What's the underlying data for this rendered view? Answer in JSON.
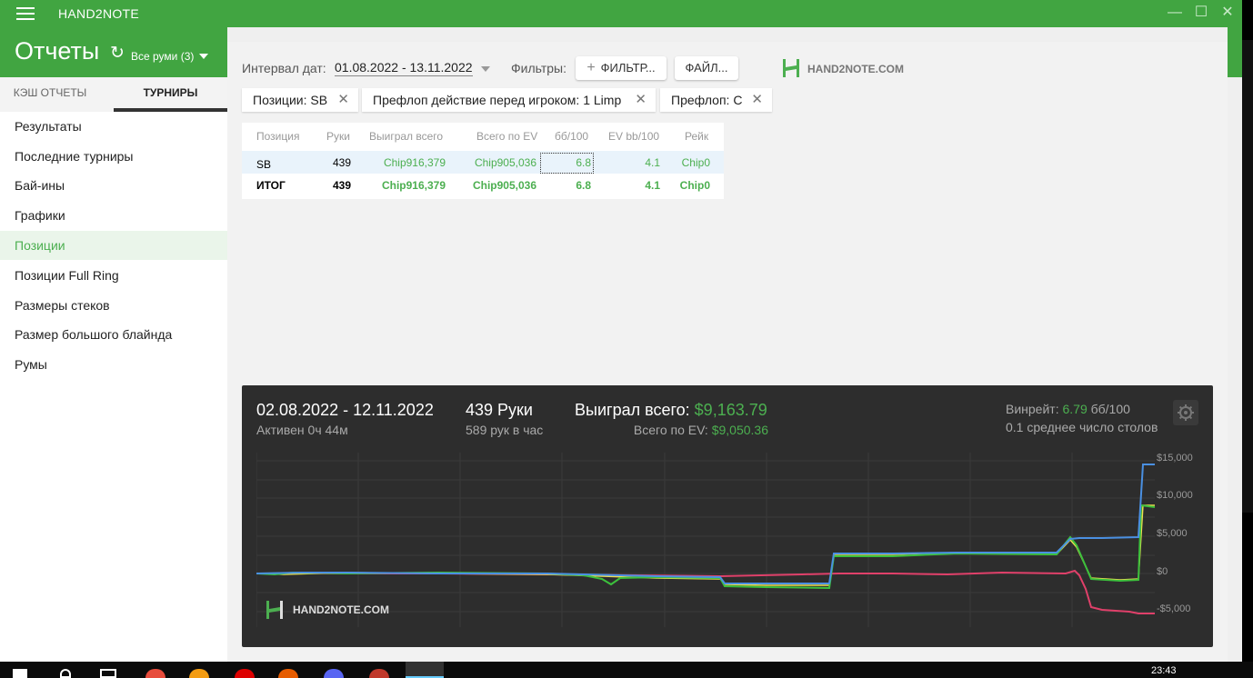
{
  "window": {
    "title": "HAND2NOTE",
    "minimize_icon": "minimize-icon",
    "maximize_icon": "maximize-icon",
    "close_icon": "close-icon"
  },
  "header": {
    "title": "Отчеты",
    "rooms_label": "Все руми (3)"
  },
  "sidebar": {
    "tabs": [
      {
        "label": "КЭШ ОТЧЕТЫ",
        "active": false
      },
      {
        "label": "ТУРНИРЫ",
        "active": true
      }
    ],
    "items": [
      {
        "label": "Результаты",
        "active": false
      },
      {
        "label": "Последние турниры",
        "active": false
      },
      {
        "label": "Бай-ины",
        "active": false
      },
      {
        "label": "Графики",
        "active": false
      },
      {
        "label": "Позиции",
        "active": true
      },
      {
        "label": "Позиции Full Ring",
        "active": false
      },
      {
        "label": "Размеры стеков",
        "active": false
      },
      {
        "label": "Размер большого блайнда",
        "active": false
      },
      {
        "label": "Румы",
        "active": false
      }
    ]
  },
  "toolbar": {
    "date_label": "Интервал дат:",
    "date_range": "01.08.2022 - 13.11.2022",
    "filters_label": "Фильтры:",
    "filter_button": "ФИЛЬТР...",
    "filter_plus": "+",
    "file_button": "ФАЙЛ...",
    "logo_text": "HAND2NOTE.COM"
  },
  "chips": [
    {
      "label": "Позиции: SB"
    },
    {
      "label": "Префлоп действие перед игроком: 1 Limp"
    },
    {
      "label": "Префлоп: C"
    }
  ],
  "table": {
    "headers": [
      "Позиция",
      "Руки",
      "Выиграл всего",
      "Всего по EV",
      "бб/100",
      "EV bb/100",
      "Рейк"
    ],
    "rows": [
      [
        "SB",
        "439",
        "Chip916,379",
        "Chip905,036",
        "6.8",
        "4.1",
        "Chip0"
      ]
    ],
    "total": [
      "ИТОГ",
      "439",
      "Chip916,379",
      "Chip905,036",
      "6.8",
      "4.1",
      "Chip0"
    ]
  },
  "graph": {
    "date_range": "02.08.2022 - 12.11.2022",
    "active_time": "Активен 0ч 44м",
    "hands": "439 Руки",
    "hands_per_hour": "589 рук в час",
    "won_label": "Выиграл всего:",
    "won_value": "$9,163.79",
    "ev_label": "Всего по EV:",
    "ev_value": "$9,050.36",
    "winrate_label": "Винрейт:",
    "winrate_value": "6.79",
    "winrate_unit": "бб/100",
    "tables_text": "0.1 среднее число столов",
    "logo_text": "HAND2NOTE.COM",
    "gear_icon": "gear-icon",
    "y_ticks": [
      "$15,000",
      "$10,000",
      "$5,000",
      "$0",
      "-$5,000"
    ],
    "colors": {
      "won": "#4a90e2",
      "ev": "#f0e050",
      "sd": "#3cc03c",
      "nosd": "#e0406a",
      "accent": "#4caf50"
    }
  },
  "taskbar": {
    "clock": "23:43"
  }
}
